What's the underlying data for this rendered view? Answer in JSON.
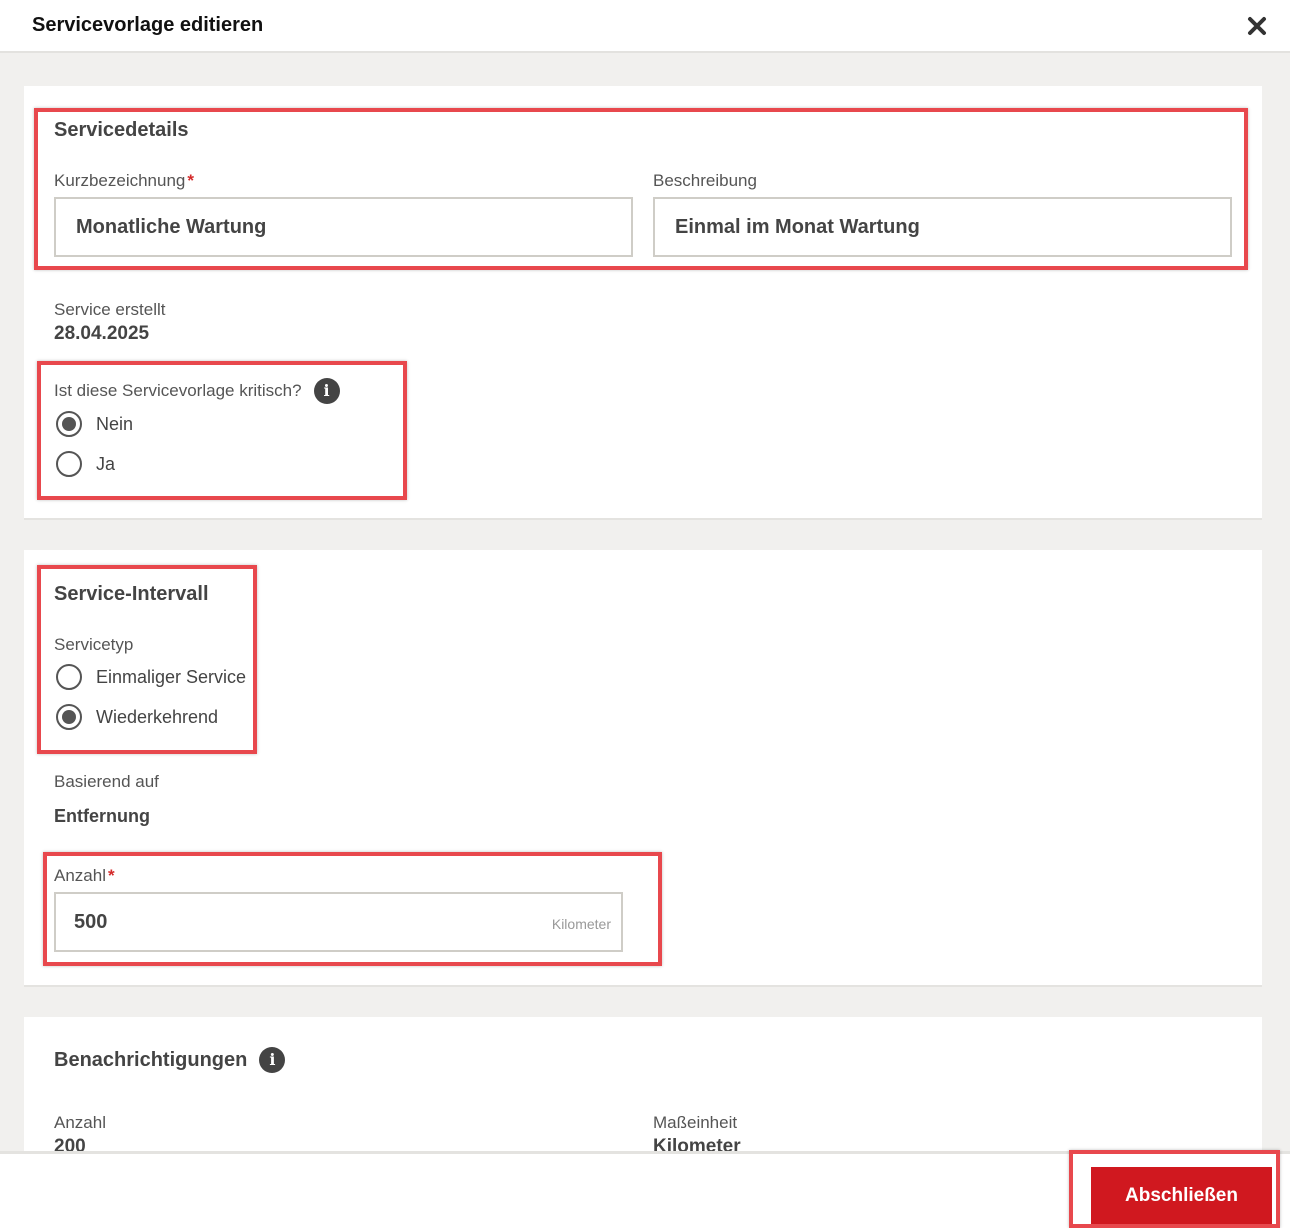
{
  "dialog": {
    "title": "Servicevorlage editieren",
    "close_icon": "close-icon"
  },
  "details": {
    "heading": "Servicedetails",
    "short_name_label": "Kurzbezeichnung",
    "required_mark": "*",
    "short_name_value": "Monatliche Wartung",
    "description_label": "Beschreibung",
    "description_value": "Einmal im Monat Wartung",
    "created_label": "Service erstellt",
    "created_value": "28.04.2025",
    "critical_question": "Ist diese Servicevorlage kritisch?",
    "critical_options": [
      {
        "label": "Nein",
        "selected": true
      },
      {
        "label": "Ja",
        "selected": false
      }
    ]
  },
  "interval": {
    "heading": "Service-Intervall",
    "type_label": "Servicetyp",
    "type_options": [
      {
        "label": "Einmaliger Service",
        "selected": false
      },
      {
        "label": "Wiederkehrend",
        "selected": true
      }
    ],
    "based_on_label": "Basierend auf",
    "based_on_value": "Entfernung",
    "count_label": "Anzahl",
    "count_value": "500",
    "count_unit": "Kilometer"
  },
  "notifications": {
    "heading": "Benachrichtigungen",
    "count_label": "Anzahl",
    "count_value": "200",
    "unit_label": "Maßeinheit",
    "unit_value": "Kilometer"
  },
  "footer": {
    "finish_label": "Abschließen"
  },
  "colors": {
    "accent": "#d0181f",
    "highlight": "#e8484d",
    "background": "#f1f0ee"
  }
}
